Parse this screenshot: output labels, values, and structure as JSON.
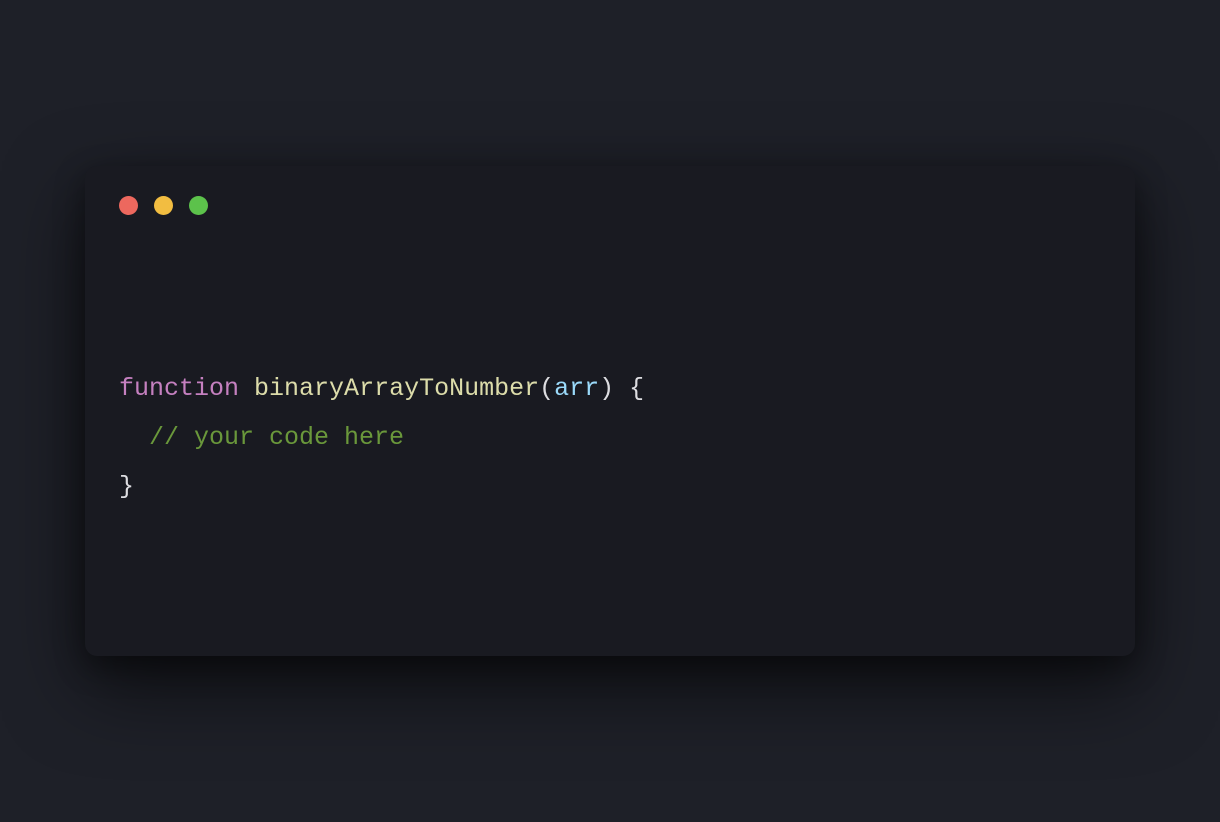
{
  "code": {
    "keyword": "function",
    "space1": " ",
    "funcname": "binaryArrayToNumber",
    "open_paren": "(",
    "param": "arr",
    "close_paren": ")",
    "space2": " ",
    "open_brace": "{",
    "line2_indent": "  ",
    "comment": "// your code here",
    "close_brace": "}"
  }
}
